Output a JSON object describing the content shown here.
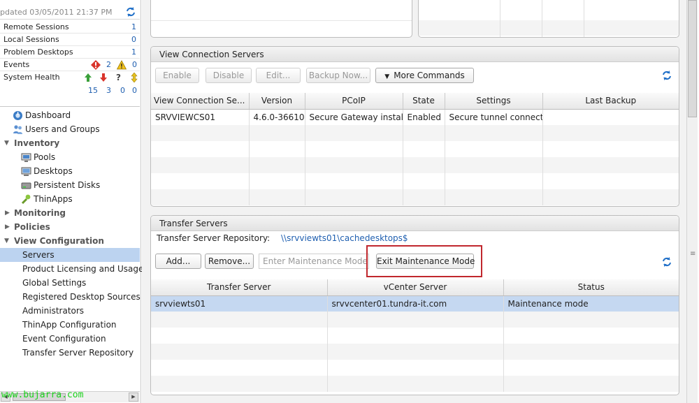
{
  "left": {
    "updated": "pdated 03/05/2011 21:37 PM",
    "stats": [
      {
        "label": "Remote Sessions",
        "value": "1"
      },
      {
        "label": "Local Sessions",
        "value": "0"
      },
      {
        "label": "Problem Desktops",
        "value": "1"
      }
    ],
    "events": {
      "label": "Events",
      "errors": "2",
      "warnings": "0"
    },
    "health": {
      "label": "System Health",
      "up": "15",
      "down": "3",
      "unknown": "0",
      "other": "0"
    },
    "tree": {
      "dashboard": "Dashboard",
      "users_groups": "Users and Groups",
      "inventory": "Inventory",
      "pools": "Pools",
      "desktops": "Desktops",
      "persistent_disks": "Persistent Disks",
      "thinapps": "ThinApps",
      "monitoring": "Monitoring",
      "policies": "Policies",
      "view_config": "View Configuration",
      "servers": "Servers",
      "licensing": "Product Licensing and Usage",
      "global_settings": "Global Settings",
      "registered_sources": "Registered Desktop Sources",
      "administrators": "Administrators",
      "thinapp_config": "ThinApp Configuration",
      "event_config": "Event Configuration",
      "transfer_repo": "Transfer Server Repository"
    },
    "watermark": "www.bujarra.com"
  },
  "vcs": {
    "title": "View Connection Servers",
    "buttons": {
      "enable": "Enable",
      "disable": "Disable",
      "edit": "Edit...",
      "backup": "Backup Now...",
      "more": "More Commands"
    },
    "columns": [
      "View Connection Se...",
      "Version",
      "PCoIP",
      "State",
      "Settings",
      "Last Backup"
    ],
    "row": {
      "name": "SRVVIEWCS01",
      "version": "4.6.0-36610",
      "pcoip": "Secure Gateway installe",
      "state": "Enabled",
      "settings": "Secure tunnel connecti",
      "backup": ""
    }
  },
  "ts": {
    "title": "Transfer Servers",
    "repo_label": "Transfer Server Repository:",
    "repo_path": "\\\\srvviewts01\\cachedesktops$",
    "buttons": {
      "add": "Add...",
      "remove": "Remove...",
      "enter": "Enter Maintenance Mode...",
      "exit": "Exit Maintenance Mode"
    },
    "columns": [
      "Transfer Server",
      "vCenter Server",
      "Status"
    ],
    "row": {
      "server": "srvviewts01",
      "vcenter": "srvvcenter01.tundra-it.com",
      "status": "Maintenance mode"
    }
  },
  "colors": {
    "accent": "#1f5fb0",
    "highlight": "#c0272d",
    "selected": "#c5d8f1"
  }
}
